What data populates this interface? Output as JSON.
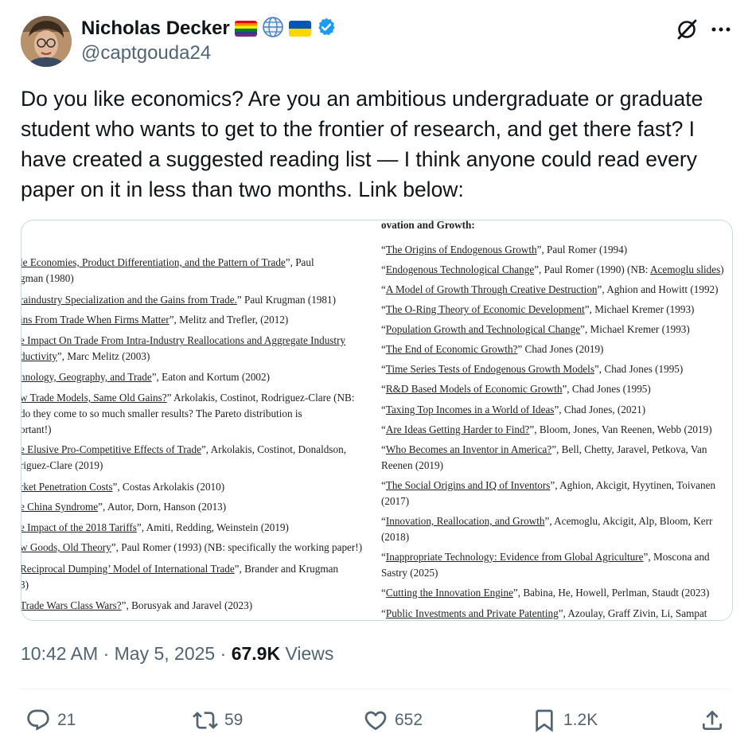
{
  "author": {
    "name": "Nicholas Decker",
    "handle": "@captgouda24",
    "badges": [
      "rainbow-flag-icon",
      "globe-icon",
      "ukraine-flag-icon",
      "verified-badge-icon"
    ]
  },
  "header_actions": {
    "grok_icon": "grok-icon",
    "more_icon": "more-icon"
  },
  "tweet": {
    "text": "Do you like economics? Are you an ambitious undergraduate or graduate student who wants to get to the frontier of research, and get there fast? I have created a suggested reading list — I think anyone could read every paper on it in less than two months. Link below:"
  },
  "media": {
    "left_entries": [
      {
        "lines": [
          [
            "le Economies, Product Differentiation, and the Pattern of Trade",
            "”, Paul"
          ],
          [
            "",
            "gman (1980)"
          ]
        ]
      },
      {
        "lines": [
          [
            "raindustry Specialization and the Gains from Trade.",
            "” Paul Krugman (1981)"
          ]
        ]
      },
      {
        "lines": [
          [
            "ins From Trade When Firms Matter",
            "”, Melitz and Trefler, (2012)"
          ]
        ]
      },
      {
        "lines": [
          [
            "e Impact On Trade From Intra-Industry Reallocations and Aggregate Industry",
            ""
          ],
          [
            "ductivity",
            "”, Marc Melitz (2003)"
          ]
        ]
      },
      {
        "lines": [
          [
            "hnology, Geography, and Trade",
            "”, Eaton and Kortum (2002)"
          ]
        ]
      },
      {
        "lines": [
          [
            "w Trade Models, Same Old Gains?",
            "” Arkolakis, Costinot, Rodriguez-Clare (NB:"
          ],
          [
            "",
            " do they come to so much smaller results? The Pareto distribution is"
          ],
          [
            "",
            "ortant!)"
          ]
        ]
      },
      {
        "lines": [
          [
            "e Elusive Pro-Competitive Effects of Trade",
            "”, Arkolakis, Costinot, Donaldson,"
          ],
          [
            "",
            "riguez-Clare (2019)"
          ]
        ]
      },
      {
        "lines": [
          [
            "rket Penetration Costs",
            "”, Costas Arkolakis (2010)"
          ]
        ]
      },
      {
        "lines": [
          [
            "e China Syndrome",
            "”, Autor, Dorn, Hanson (2013)"
          ]
        ]
      },
      {
        "lines": [
          [
            "e Impact of the 2018 Tariffs",
            "”, Amiti, Redding, Weinstein (2019)"
          ]
        ]
      },
      {
        "lines": [
          [
            "w Goods, Old Theory",
            "”, Paul Romer (1993) (NB: specifically the working paper!)"
          ]
        ]
      },
      {
        "lines": [
          [
            "Reciprocal Dumping’ Model of International Trade",
            "”, Brander and Krugman"
          ],
          [
            "",
            "3)"
          ]
        ]
      },
      {
        "lines": [
          [
            " Trade Wars Class Wars?",
            "”, Borusyak and Jaravel (2023)"
          ]
        ]
      }
    ],
    "right_title": "ovation and Growth:",
    "right_entries": [
      {
        "lines": [
          [
            "“",
            "The Origins of Endogenous Growth",
            "”, Paul Romer (1994)"
          ]
        ]
      },
      {
        "lines": [
          [
            "“",
            "Endogenous Technological Change",
            "”, Paul Romer (1990) (NB: ",
            "Acemoglu slides",
            ")"
          ]
        ]
      },
      {
        "lines": [
          [
            "“",
            "A Model of Growth Through Creative Destruction",
            "”, Aghion and Howitt (1992)"
          ]
        ]
      },
      {
        "lines": [
          [
            "“",
            "The O-Ring Theory of Economic Development",
            "”, Michael Kremer (1993)"
          ]
        ]
      },
      {
        "lines": [
          [
            "“",
            "Population Growth and Technological Change",
            "”, Michael Kremer (1993)"
          ]
        ]
      },
      {
        "lines": [
          [
            "“",
            "The End of Economic Growth?",
            "” Chad Jones (2019)"
          ]
        ]
      },
      {
        "lines": [
          [
            "“",
            "Time Series Tests of Endogenous Growth Models",
            "”, Chad Jones (1995)"
          ]
        ]
      },
      {
        "lines": [
          [
            "“",
            "R&D Based Models of Economic Growth",
            "”, Chad Jones (1995)"
          ]
        ]
      },
      {
        "lines": [
          [
            "“",
            "Taxing Top Incomes in a World of Ideas",
            "”, Chad Jones, (2021)"
          ]
        ]
      },
      {
        "lines": [
          [
            "“",
            "Are Ideas Getting Harder to Find?",
            "”, Bloom, Jones, Van Reenen, Webb (2019)"
          ]
        ]
      },
      {
        "lines": [
          [
            "“",
            "Who Becomes an Inventor in America?",
            "”, Bell, Chetty, Jaravel, Petkova, Van"
          ],
          [
            "",
            "",
            "Reenen (2019)"
          ]
        ]
      },
      {
        "lines": [
          [
            "“",
            "The Social Origins and IQ of Inventors",
            "”, Aghion, Akcigit, Hyytinen, Toivanen"
          ],
          [
            "",
            "",
            "(2017)"
          ]
        ]
      },
      {
        "lines": [
          [
            "“",
            "Innovation, Reallocation, and Growth",
            "”, Acemoglu, Akcigit, Alp, Bloom, Kerr"
          ],
          [
            "",
            "",
            "(2018)"
          ]
        ]
      },
      {
        "lines": [
          [
            "“",
            "Inappropriate Technology: Evidence from Global Agriculture",
            "”, Moscona and"
          ],
          [
            "",
            "",
            "Sastry (2025)"
          ]
        ]
      },
      {
        "lines": [
          [
            "“",
            "Cutting the Innovation Engine",
            "”, Babina, He, Howell, Perlman, Staudt (2023)"
          ]
        ]
      },
      {
        "lines": [
          [
            "“",
            "Public Investments and Private Patenting",
            "”, Azoulay, Graff Zivin, Li, Sampat"
          ]
        ]
      }
    ]
  },
  "meta": {
    "time": "10:42 AM",
    "separator": "·",
    "date": "May 5, 2025",
    "views_count": "67.9K",
    "views_label": "Views"
  },
  "actions": {
    "replies": "21",
    "reposts": "59",
    "likes": "652",
    "bookmarks": "1.2K"
  },
  "colors": {
    "text": "#0f1419",
    "secondary": "#536471",
    "verified": "#1d9bf0",
    "border": "#cfd9de"
  }
}
